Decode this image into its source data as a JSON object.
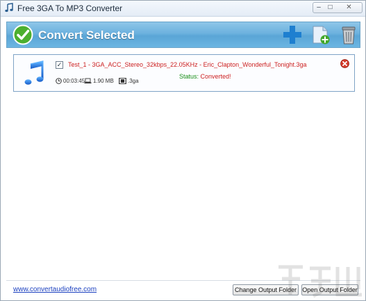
{
  "window": {
    "title": "Free 3GA To MP3 Converter",
    "controls": {
      "minimize": "–",
      "maximize": "□",
      "close": "✕"
    }
  },
  "header": {
    "convert_label": "Convert Selected",
    "icons": [
      "check-circle-icon",
      "add-plus-icon",
      "add-folder-icon",
      "trash-icon"
    ],
    "colors": {
      "bar_top": "#8ec6e8",
      "bar_bottom": "#5aa5d6",
      "accent_blue": "#1e7fd0",
      "check_green": "#4caf2f"
    }
  },
  "files": [
    {
      "checked": true,
      "check_glyph": "✓",
      "name": "Test_1 - 3GA_ACC_Stereo_32kbps_22.05KHz - Eric_Clapton_Wonderful_Tonight.3ga",
      "duration": "00:03:45",
      "size": "1.90 MB",
      "format": ".3ga",
      "status_label": "Status: ",
      "status_value": "Converted!"
    }
  ],
  "footer": {
    "website": "www.convertaudiofree.com",
    "change_output_label": "Change Output Folder",
    "open_output_label": "Open Output Folder"
  }
}
